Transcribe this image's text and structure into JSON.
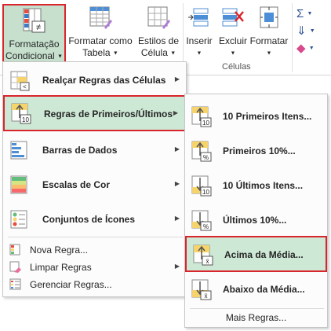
{
  "ribbon": {
    "conditional_formatting": {
      "line1": "Formatação",
      "line2": "Condicional"
    },
    "format_as_table": {
      "line1": "Formatar como",
      "line2": "Tabela"
    },
    "cell_styles": {
      "line1": "Estilos de",
      "line2": "Célula"
    },
    "insert": "Inserir",
    "delete": "Excluir",
    "format": "Formatar",
    "cells_group": "Células"
  },
  "main_menu": {
    "items": [
      {
        "label": "Realçar Regras das Células",
        "has_submenu": true
      },
      {
        "label": "Regras de Primeiros/Últimos",
        "has_submenu": true,
        "highlighted": true
      },
      {
        "label": "Barras de Dados",
        "has_submenu": true
      },
      {
        "label": "Escalas de Cor",
        "has_submenu": true
      },
      {
        "label": "Conjuntos de Ícones",
        "has_submenu": true
      }
    ],
    "actions": [
      {
        "label": "Nova Regra..."
      },
      {
        "label": "Limpar Regras",
        "has_submenu": true
      },
      {
        "label": "Gerenciar Regras..."
      }
    ]
  },
  "sub_menu": {
    "items": [
      {
        "label": "10 Primeiros Itens...",
        "icon_badge": "10"
      },
      {
        "label": "Primeiros 10%...",
        "icon_badge": "%"
      },
      {
        "label": "10 Últimos Itens...",
        "icon_badge": "10"
      },
      {
        "label": "Últimos 10%...",
        "icon_badge": "%"
      },
      {
        "label": "Acima da Média...",
        "icon_badge": "x̄",
        "highlighted": true
      },
      {
        "label": "Abaixo da Média...",
        "icon_badge": "x̄"
      }
    ],
    "more_rules": "Mais Regras..."
  },
  "colors": {
    "accent_green": "#cde8d4",
    "highlight_border": "#d9262c"
  }
}
